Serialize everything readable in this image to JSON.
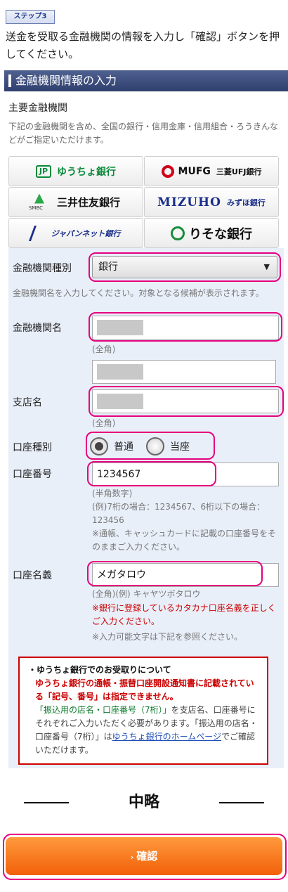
{
  "step": "ステップ3",
  "intro": "送金を受取る金融機関の情報を入力し「確認」ボタンを押してください。",
  "section_title": "金融機関情報の入力",
  "major_banks": {
    "title": "主要金融機関",
    "desc": "下記の金融機関を含め、全国の銀行・信用金庫・信用組合・ろうきんなどがご指定いただけます。",
    "banks": {
      "yucho": {
        "mark": "JP",
        "name": "ゆうちょ銀行"
      },
      "mufg": {
        "name": "MUFG",
        "sub": "三菱UFJ銀行"
      },
      "smbc": {
        "mark": "SMBC",
        "name": "三井住友銀行"
      },
      "mizuho": {
        "name": "MIZUHO",
        "sub": "みずほ銀行"
      },
      "japannet": {
        "name": "ジャパンネット銀行"
      },
      "resona": {
        "name": "りそな銀行"
      }
    }
  },
  "form": {
    "institution_type": {
      "label": "金融機関種別",
      "value": "銀行",
      "arrow": "▼"
    },
    "institution_hint": "金融機関名を入力してください。対象となる候補が表示されます。",
    "institution_name": {
      "label": "金融機関名",
      "note": "(全角)"
    },
    "branch_name": {
      "label": "支店名",
      "note": "(全角)"
    },
    "account_type": {
      "label": "口座種別",
      "options": [
        "普通",
        "当座"
      ],
      "selected": "普通"
    },
    "account_number": {
      "label": "口座番号",
      "value": "1234567",
      "notes": [
        "(半角数字)",
        "(例)7桁の場合：1234567、6桁以下の場合：123456",
        "※通帳、キャッシュカードに記載の口座番号をそのままご入力ください。"
      ]
    },
    "account_holder": {
      "label": "口座名義",
      "value": "メガタロウ",
      "note": "(全角)(例) キャヤツボタロウ",
      "warning": "※銀行に登録しているカタカナ口座名義を正しくご入力ください。",
      "chars_note": "※入力可能文字は下記を参照ください。"
    }
  },
  "yucho_notice": {
    "title": "・ゆうちょ銀行でのお受取りについて",
    "red": "ゆうちょ銀行の通帳・振替口座開設通知書に記載されている「記号、番号」は指定できません。",
    "green": "「振込用の店名・口座番号（7桁）」",
    "grey1": "を支店名、口座番号にそれぞれご入力いただく必要があります。「振込用の店名・口座番号（7桁）」は",
    "link": "ゆうちょ銀行のホームページ",
    "grey2": "でご確認いただけます。"
  },
  "omitted_label": "中略",
  "confirm_button": {
    "chevron": "›",
    "label": "確認"
  },
  "colors": {
    "highlight": "#e6007e",
    "section_bar": "#3a4a7a",
    "form_bg": "#e9eff9",
    "confirm": "#f57615",
    "warning": "#cc0000"
  }
}
